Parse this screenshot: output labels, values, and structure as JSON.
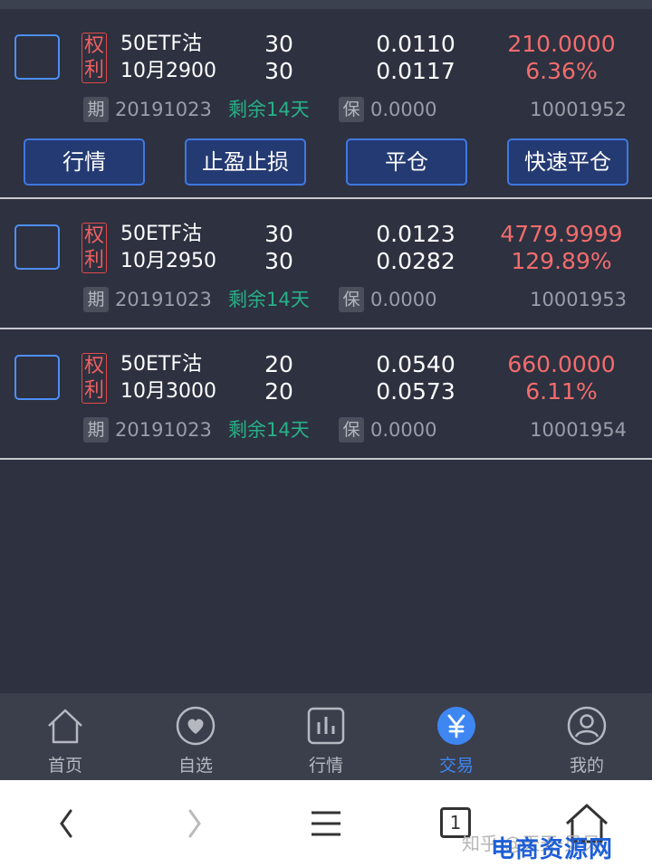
{
  "positions": [
    {
      "tag": "权利",
      "name_line1": "50ETF沽",
      "name_line2": "10月2900",
      "qty_1": "30",
      "qty_2": "30",
      "price_1": "0.0110",
      "price_2": "0.0117",
      "pnl_amount": "210.0000",
      "pnl_pct": "6.36%",
      "expiry_badge": "期",
      "expiry_date": "20191023",
      "remaining": "剩余14天",
      "margin_badge": "保",
      "margin_value": "0.0000",
      "contract_code": "10001952",
      "actions": [
        "行情",
        "止盈止损",
        "平仓",
        "快速平仓"
      ]
    },
    {
      "tag": "权利",
      "name_line1": "50ETF沽",
      "name_line2": "10月2950",
      "qty_1": "30",
      "qty_2": "30",
      "price_1": "0.0123",
      "price_2": "0.0282",
      "pnl_amount": "4779.9999",
      "pnl_pct": "129.89%",
      "expiry_badge": "期",
      "expiry_date": "20191023",
      "remaining": "剩余14天",
      "margin_badge": "保",
      "margin_value": "0.0000",
      "contract_code": "10001953"
    },
    {
      "tag": "权利",
      "name_line1": "50ETF沽",
      "name_line2": "10月3000",
      "qty_1": "20",
      "qty_2": "20",
      "price_1": "0.0540",
      "price_2": "0.0573",
      "pnl_amount": "660.0000",
      "pnl_pct": "6.11%",
      "expiry_badge": "期",
      "expiry_date": "20191023",
      "remaining": "剩余14天",
      "margin_badge": "保",
      "margin_value": "0.0000",
      "contract_code": "10001954"
    }
  ],
  "tabbar": {
    "items": [
      {
        "label": "首页",
        "icon": "home-icon"
      },
      {
        "label": "自选",
        "icon": "heart-icon"
      },
      {
        "label": "行情",
        "icon": "bar-chart-icon"
      },
      {
        "label": "交易",
        "icon": "yuan-icon",
        "active": true
      },
      {
        "label": "我的",
        "icon": "user-icon"
      }
    ]
  },
  "browser_nav": {
    "tab_count": "1"
  },
  "watermark": {
    "zhihu": "知乎 @天天·贝贝",
    "site": "电商资源网"
  },
  "colors": {
    "background": "#2d3140",
    "accent_blue": "#3e86f2",
    "profit_red": "#f36c6c",
    "remaining_green": "#27b087"
  }
}
